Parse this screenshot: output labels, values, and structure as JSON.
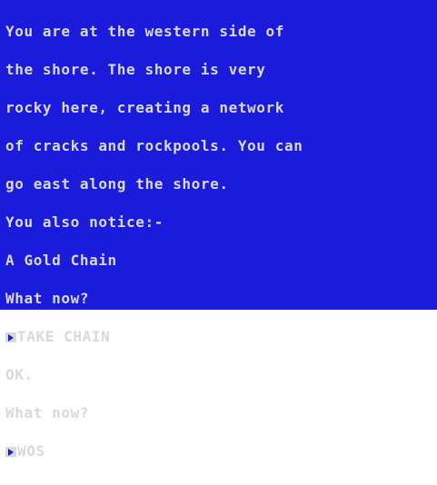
{
  "game": {
    "description": [
      "You are at the western side of",
      "the shore. The shore is very",
      "rocky here, creating a network",
      "of cracks and rockpools. You can",
      "go east along the shore."
    ],
    "notice_header": "You also notice:-",
    "notice_item": "A Gold Chain",
    "prompt1": "What now?",
    "command1": "TAKE CHAIN",
    "response1": "OK.",
    "prompt2": "What now?",
    "command2": "WOS",
    "cursor_icon": "prompt-cursor-icon",
    "colors": {
      "paper": "#1b1bdc",
      "ink": "#d9d9d9",
      "border": "#ffffff"
    }
  }
}
